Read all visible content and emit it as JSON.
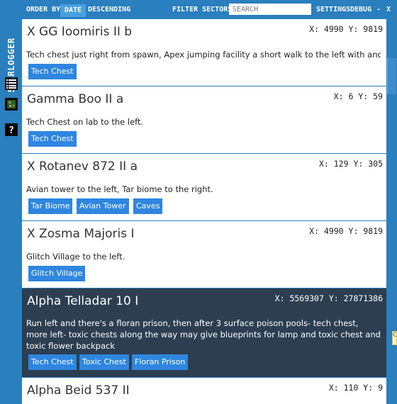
{
  "topbar": {
    "order_by_label": "ORDER BY",
    "date_label": "DATE",
    "descending_label": "DESCENDING",
    "filter_label": "FILTER SECTORS",
    "search_placeholder": "SEARCH",
    "settings_label": "SETTINGS",
    "debug_label": "DEBUG",
    "minimize_label": "-",
    "close_label": "X"
  },
  "sidebar": {
    "brand": "STARLOGGER"
  },
  "entries": [
    {
      "title": "X GG Ioomiris II b",
      "coords": "X: 4990 Y: 9819",
      "desc": "Tech chest just right from spawn, Apex jumping facility a short walk to the left with anoth...",
      "tags": [
        "Tech Chest"
      ]
    },
    {
      "title": "Gamma Boo II a",
      "coords": "X: 6 Y: 59",
      "desc": "Tech Chest on lab to the left.",
      "tags": [
        "Tech Chest"
      ]
    },
    {
      "title": "X Rotanev 872 II a",
      "coords": "X: 129 Y: 305",
      "desc": "Avian tower to the left, Tar biome to the right.",
      "tags": [
        "Tar Biome",
        "Avian Tower",
        "Caves"
      ]
    },
    {
      "title": "X Zosma Majoris I",
      "coords": "X: 4990 Y: 9819",
      "desc": "Glitch Village to the left.",
      "tags": [
        "Glitch Village"
      ]
    },
    {
      "title": "Alpha Telladar 10 I",
      "coords": "X: 5569307 Y: 27871386",
      "desc": "Run left and there's a floran prison, then after 3 surface poison pools- tech chest, more left- toxic chests along the way may give blueprints for lamp and toxic chest and toxic flower backpack",
      "tags": [
        "Tech Chest",
        "Toxic Chest",
        "Floran Prison"
      ]
    },
    {
      "title": "Alpha Beid 537 II",
      "coords": "X: 110 Y: 9",
      "desc": "",
      "tags": []
    }
  ],
  "colors": {
    "accent": "#2a7fbf",
    "tag": "#2e86e0",
    "selected_row": "#2c3e50"
  },
  "icons": [
    "list-icon",
    "planet-icon",
    "help-icon"
  ],
  "yellow_tab": "C"
}
